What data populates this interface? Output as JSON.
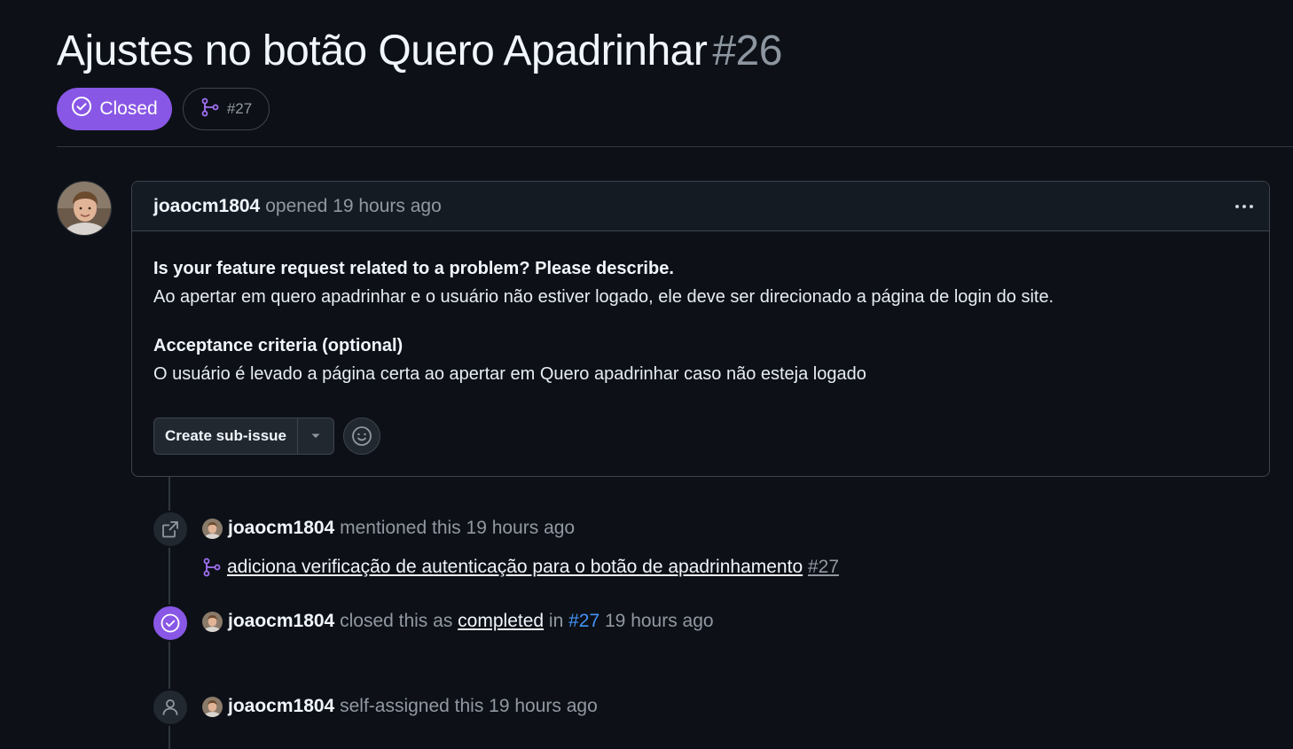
{
  "issue": {
    "title": "Ajustes no botão Quero Apadrinhar",
    "number": "#26",
    "state": "Closed",
    "linked_pr": "#27",
    "state_color": "#8957e5"
  },
  "comment": {
    "author": "joaocm1804",
    "meta": "opened 19 hours ago",
    "heading1": "Is your feature request related to a problem? Please describe.",
    "para1": "Ao apertar em quero apadrinhar e o usuário não estiver logado, ele deve ser direcionado a página de login do site.",
    "heading2": "Acceptance criteria (optional)",
    "para2": "O usuário é levado a página certa ao apertar em Quero apadrinhar caso não esteja logado",
    "create_sub_issue": "Create sub-issue"
  },
  "timeline": {
    "mention": {
      "author": "joaocm1804",
      "text": "mentioned this 19 hours ago",
      "pr_title": "adiciona verificação de autenticação para o botão de apadrinhamento",
      "pr_number": "#27"
    },
    "closed": {
      "author": "joaocm1804",
      "text1": "closed this as",
      "completed": "completed",
      "in": "in",
      "pr": "#27",
      "time": "19 hours ago"
    },
    "assigned": {
      "author": "joaocm1804",
      "text": "self-assigned this 19 hours ago"
    }
  }
}
